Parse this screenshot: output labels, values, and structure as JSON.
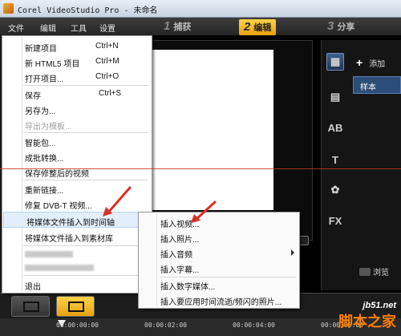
{
  "window": {
    "title": "Corel VideoStudio Pro - 未命名"
  },
  "menubar": {
    "items": [
      "文件",
      "编辑",
      "工具",
      "设置"
    ]
  },
  "steps": [
    {
      "num": "1",
      "label": "捕获"
    },
    {
      "num": "2",
      "label": "编辑"
    },
    {
      "num": "3",
      "label": "分享"
    }
  ],
  "file_menu": {
    "items": [
      {
        "label": "新建项目",
        "shortcut": "Ctrl+N"
      },
      {
        "label": "新 HTML5 项目",
        "shortcut": "Ctrl+M"
      },
      {
        "label": "打开项目...",
        "shortcut": "Ctrl+O"
      },
      {
        "label": "保存",
        "shortcut": "Ctrl+S"
      },
      {
        "label": "另存为..."
      },
      {
        "label": "导出为模板..."
      },
      {
        "label": "智能包..."
      },
      {
        "label": "成批转换..."
      },
      {
        "label": "保存修整后的视频"
      },
      {
        "label": "重新链接..."
      },
      {
        "label": "修复 DVB-T 视频..."
      },
      {
        "label": "将媒体文件插入到时间轴"
      },
      {
        "label": "将媒体文件插入到素材库"
      },
      {
        "label": "退出"
      }
    ]
  },
  "submenu": {
    "items": [
      {
        "label": "插入视频..."
      },
      {
        "label": "插入照片..."
      },
      {
        "label": "插入音频"
      },
      {
        "label": "插入字幕..."
      },
      {
        "label": "插入数字媒体..."
      },
      {
        "label": "插入要应用时间流逝/频闪的照片..."
      }
    ]
  },
  "library": {
    "add_label": "添加",
    "folder_label": "样本",
    "browse_label": "浏览"
  },
  "timeline": {
    "timecodes": [
      "00:00:00:00",
      "00:00:02:00",
      "00:00:04:00",
      "00:00:06:00"
    ]
  },
  "watermark": {
    "url": "jb51.net",
    "site": "脚本之家"
  },
  "colors": {
    "accent": "#e7a210",
    "menu_highlight": "#e3eefc",
    "annotation": "#c0392b"
  }
}
